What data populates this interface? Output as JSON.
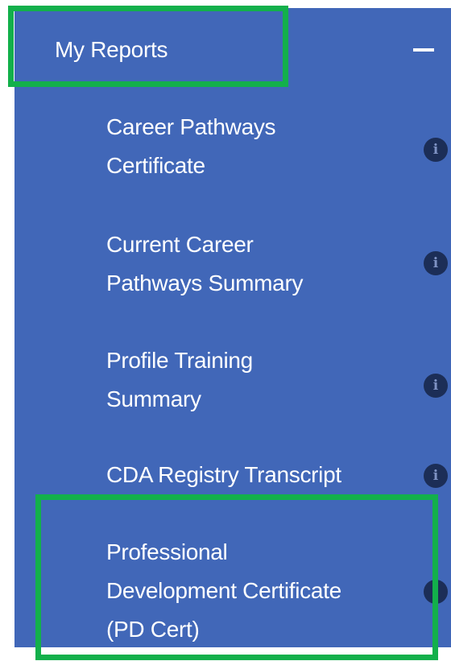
{
  "menu": {
    "title": "My Reports",
    "collapse_icon": "minus-icon",
    "items": [
      {
        "label_lines": [
          "Career Pathways",
          "Certificate"
        ],
        "icon": "info-icon",
        "icon_glyph": "i"
      },
      {
        "label_lines": [
          "Current Career",
          "Pathways Summary"
        ],
        "icon": "info-icon",
        "icon_glyph": "i"
      },
      {
        "label_lines": [
          "Profile Training",
          "Summary"
        ],
        "icon": "info-icon",
        "icon_glyph": "i"
      },
      {
        "label_lines": [
          "CDA Registry Transcript"
        ],
        "icon": "info-icon",
        "icon_glyph": "i"
      },
      {
        "label_lines": [
          "Professional",
          "Development Certificate",
          "(PD Cert)"
        ],
        "icon": "info-icon",
        "icon_glyph": "i"
      }
    ]
  },
  "colors": {
    "panel_background": "#4167b8",
    "highlight_border": "#13b04b",
    "info_icon_background": "#1c2e57",
    "text": "#ffffff"
  }
}
